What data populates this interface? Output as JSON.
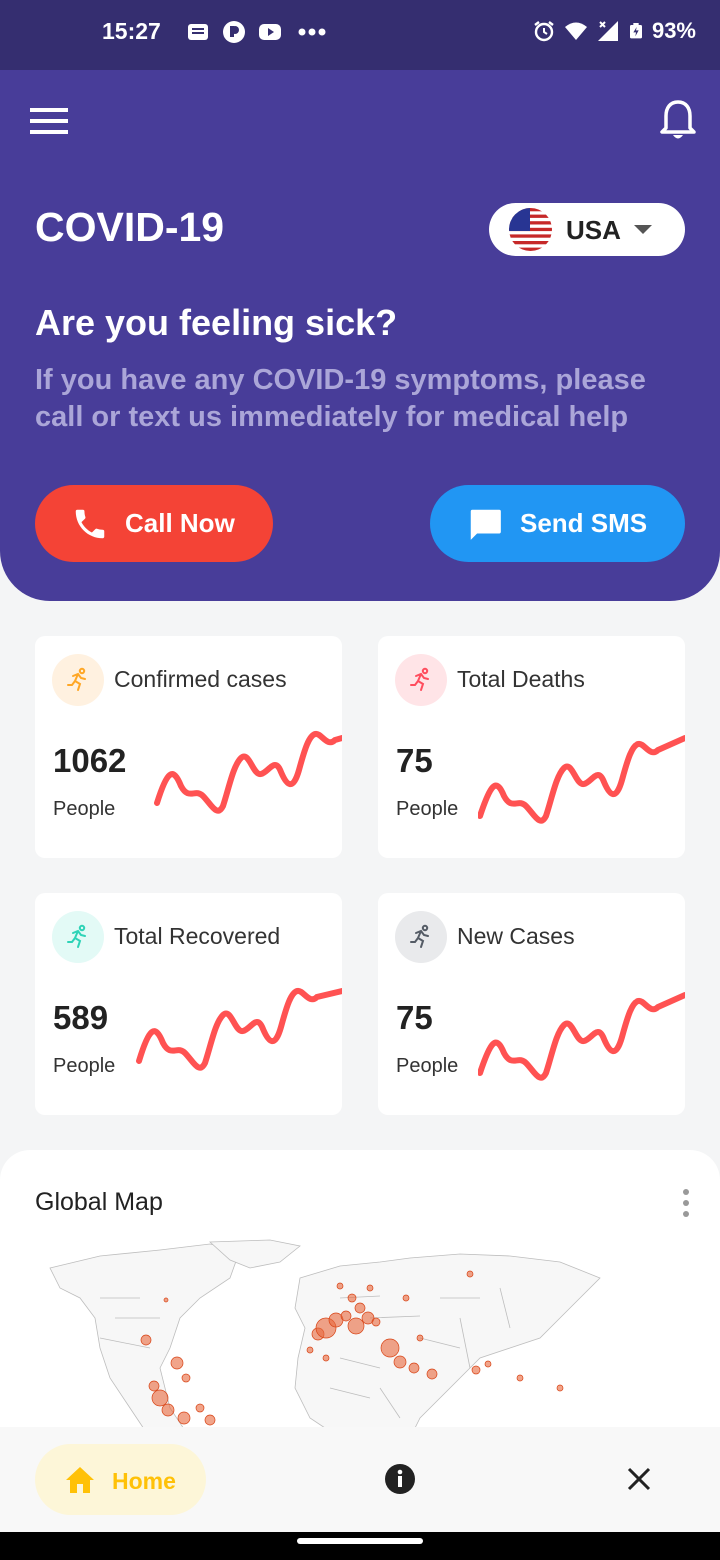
{
  "status_bar": {
    "time": "15:27",
    "battery": "93%"
  },
  "header": {
    "title": "COVID-19",
    "country": "USA",
    "headline": "Are you feeling sick?",
    "subtext": "If you have any COVID-19 symptoms, please call or text us immediately for medical help",
    "call_label": "Call Now",
    "sms_label": "Send SMS"
  },
  "colors": {
    "header_bg": "#483d99",
    "status_bg": "#352e70",
    "call": "#f44336",
    "sms": "#2196f3",
    "sparkline": "#ff5252",
    "home_accent": "#ffc107"
  },
  "stats": [
    {
      "label": "Confirmed cases",
      "value": "1062",
      "unit": "People",
      "icon": "running-icon",
      "icon_color": "#ffa726",
      "icon_bg": "#fff1e0"
    },
    {
      "label": "Total Deaths",
      "value": "75",
      "unit": "People",
      "icon": "running-icon",
      "icon_color": "#ff4d5e",
      "icon_bg": "#ffe4e7"
    },
    {
      "label": "Total Recovered",
      "value": "589",
      "unit": "People",
      "icon": "running-icon",
      "icon_color": "#2ed3b7",
      "icon_bg": "#e3faf6"
    },
    {
      "label": "New Cases",
      "value": "75",
      "unit": "People",
      "icon": "running-icon",
      "icon_color": "#555c66",
      "icon_bg": "#e9eaec"
    }
  ],
  "map": {
    "title": "Global Map"
  },
  "nav": {
    "home_label": "Home"
  }
}
